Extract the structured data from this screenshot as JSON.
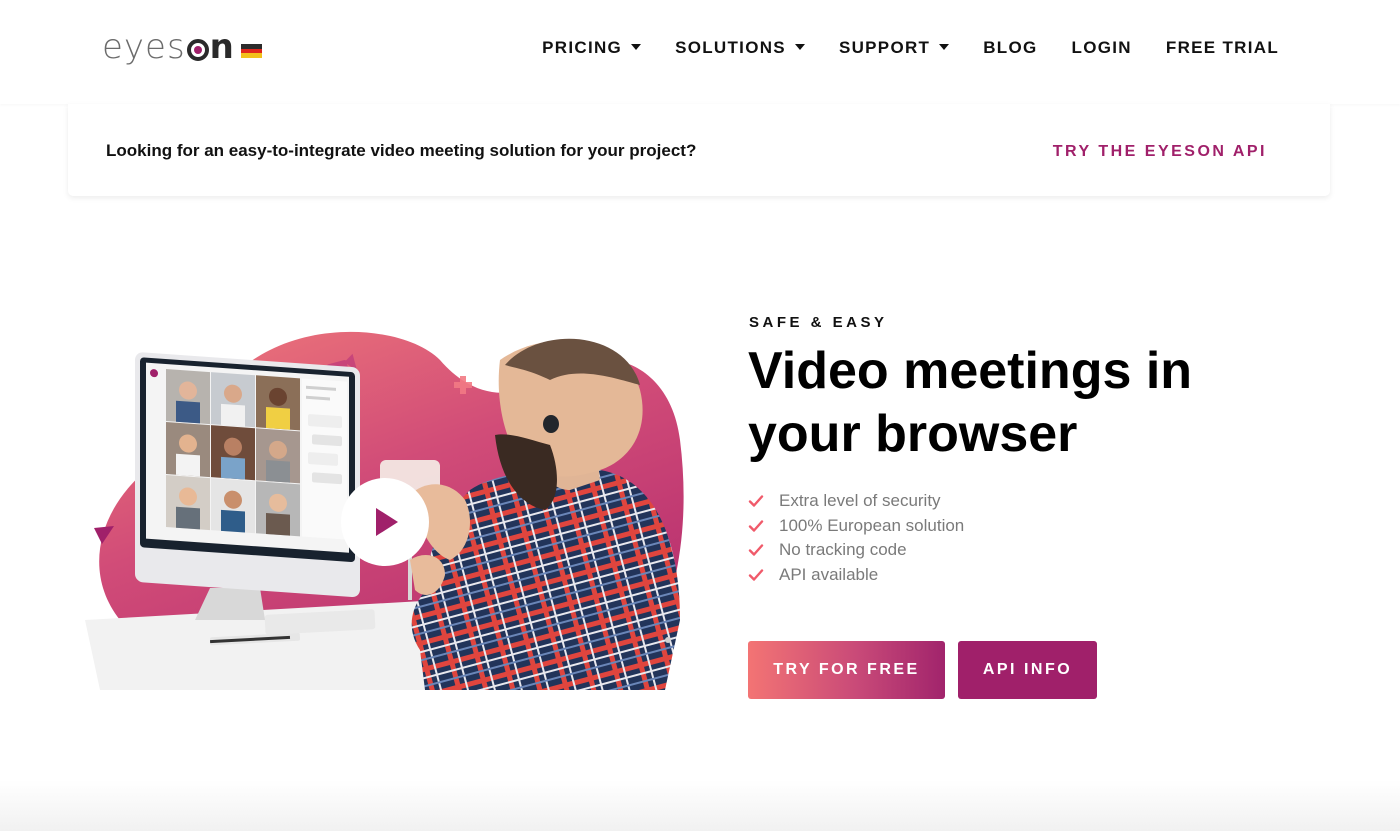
{
  "header": {
    "logo": {
      "prefix": "eyes",
      "suffix": "n"
    },
    "language_flag": "germany-flag",
    "flag_colors": [
      "#2b2b2b",
      "#e0261c",
      "#f2c11b"
    ],
    "nav": [
      {
        "label": "PRICING",
        "has_dropdown": true
      },
      {
        "label": "SOLUTIONS",
        "has_dropdown": true
      },
      {
        "label": "SUPPORT",
        "has_dropdown": true
      },
      {
        "label": "BLOG",
        "has_dropdown": false
      },
      {
        "label": "LOGIN",
        "has_dropdown": false
      },
      {
        "label": "FREE TRIAL",
        "has_dropdown": false
      }
    ]
  },
  "banner": {
    "text": "Looking for an easy-to-integrate video meeting solution for your project?",
    "link": "TRY THE EYESON API"
  },
  "hero": {
    "eyebrow": "SAFE & EASY",
    "title": "Video meetings in your browser",
    "features": [
      "Extra level of security",
      "100% European solution",
      "No tracking code",
      "API available"
    ],
    "buttons": {
      "try": "TRY FOR FREE",
      "api": "API INFO"
    },
    "image": {
      "description": "Man with headphones in plaid shirt gesturing at desktop monitor showing video call grid",
      "play_icon": "play-icon"
    }
  },
  "colors": {
    "brand": "#a0206a",
    "accent_coral": "#f37474",
    "check": "#f05a6a",
    "text_muted": "#7a7a7a"
  }
}
